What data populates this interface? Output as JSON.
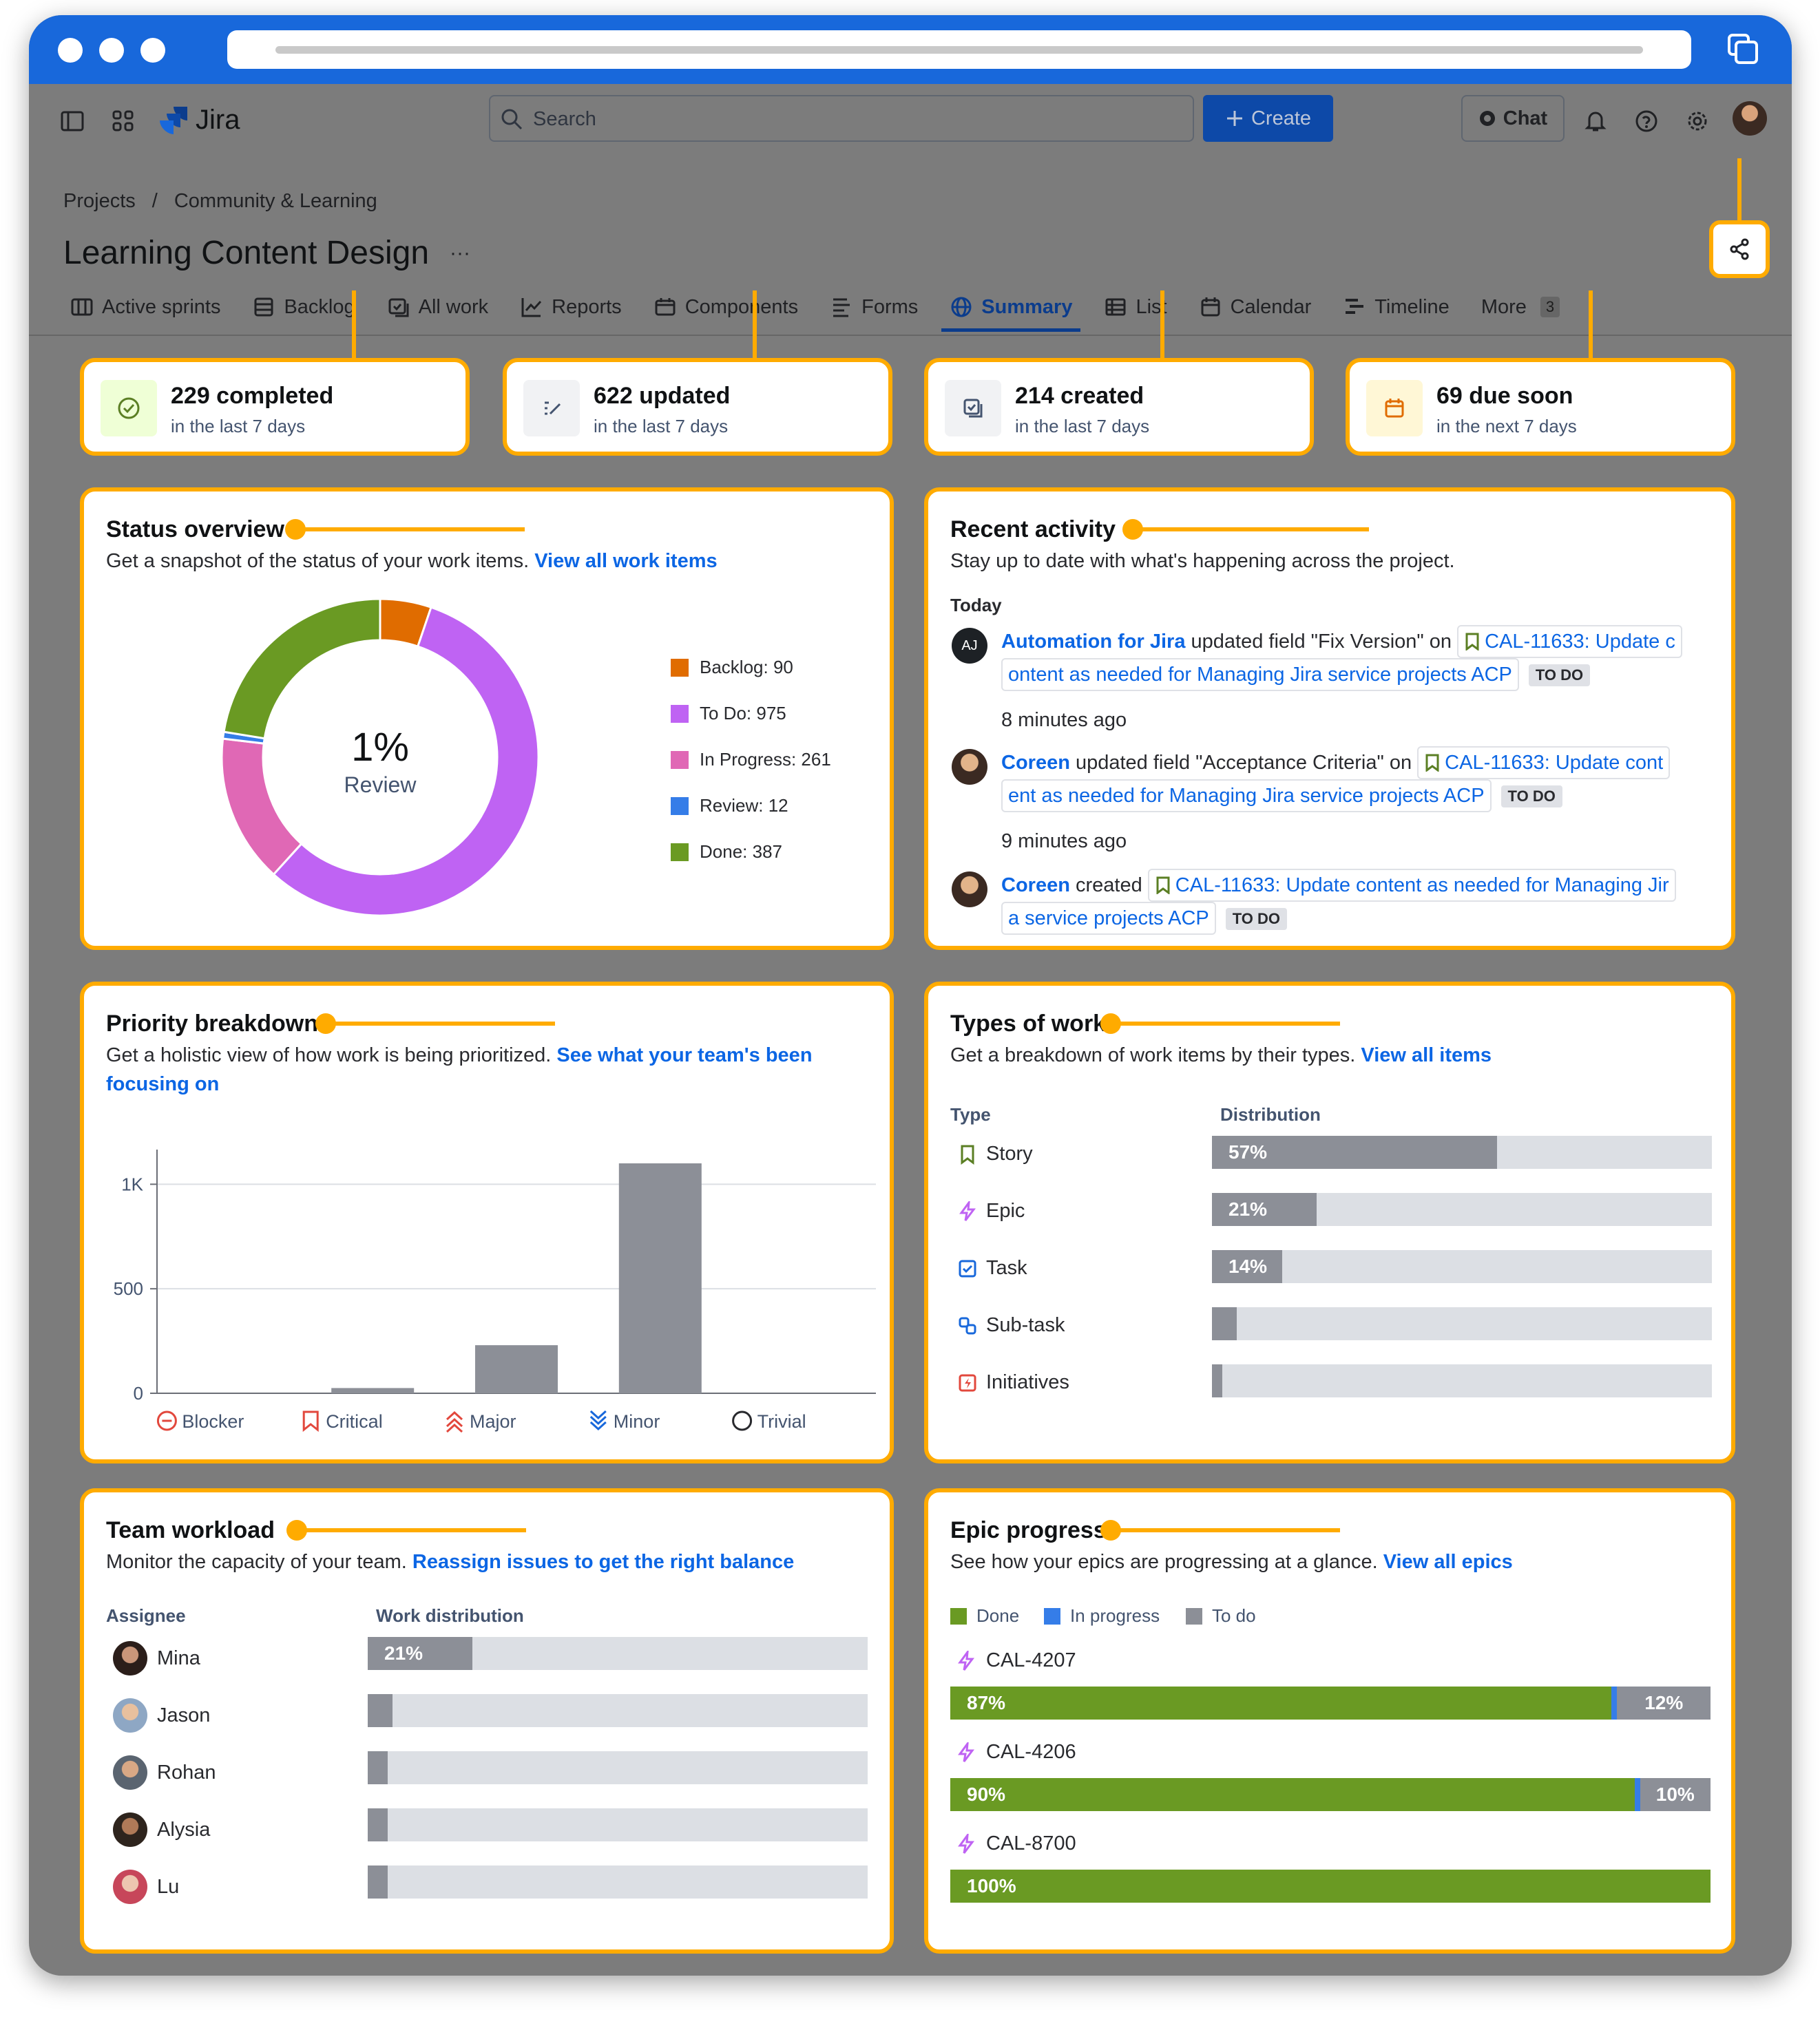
{
  "app": {
    "name": "Jira"
  },
  "topbar": {
    "search_placeholder": "Search",
    "create_label": "Create",
    "chat_label": "Chat"
  },
  "breadcrumb": {
    "root": "Projects",
    "sep": "/",
    "project": "Community & Learning"
  },
  "page": {
    "title": "Learning Content Design",
    "more": "···"
  },
  "tabs": [
    {
      "label": "Active sprints"
    },
    {
      "label": "Backlog"
    },
    {
      "label": "All work"
    },
    {
      "label": "Reports"
    },
    {
      "label": "Components"
    },
    {
      "label": "Forms"
    },
    {
      "label": "Summary"
    },
    {
      "label": "List"
    },
    {
      "label": "Calendar"
    },
    {
      "label": "Timeline"
    },
    {
      "label": "More",
      "badge": "3"
    }
  ],
  "stats": [
    {
      "big": "229 completed",
      "small": "in the last 7 days"
    },
    {
      "big": "622 updated",
      "small": "in the last 7 days"
    },
    {
      "big": "214 created",
      "small": "in the last 7 days"
    },
    {
      "big": "69 due soon",
      "small": "in the next 7 days"
    }
  ],
  "status_overview": {
    "title": "Status overview",
    "subtitle": "Get a snapshot of the status of your work items.",
    "link": "View all work items",
    "center_value": "1%",
    "center_label": "Review",
    "chart_data": {
      "type": "pie",
      "donut": true,
      "slices": [
        {
          "label": "Backlog: 90",
          "value": 90,
          "color": "#e06c00"
        },
        {
          "label": "To Do: 975",
          "value": 975,
          "color": "#bf63f3"
        },
        {
          "label": "In Progress: 261",
          "value": 261,
          "color": "#e068b5"
        },
        {
          "label": "Review: 12",
          "value": 12,
          "color": "#357de8"
        },
        {
          "label": "Done: 387",
          "value": 387,
          "color": "#6a9a23"
        }
      ]
    }
  },
  "recent_activity": {
    "title": "Recent activity",
    "subtitle": "Stay up to date with what's happening across the project.",
    "day": "Today",
    "items": [
      {
        "user": "Automation for Jira",
        "initials": "AJ",
        "action": "updated field \"Fix Version\" on",
        "item_line1": "CAL-11633: Update c",
        "item_line2": "ontent as needed for Managing Jira service projects ACP",
        "status": "TO DO",
        "time": "8 minutes ago"
      },
      {
        "user": "Coreen",
        "action": "updated field \"Acceptance Criteria\" on",
        "item_line1": "CAL-11633: Update cont",
        "item_line2": "ent as needed for Managing Jira service projects ACP",
        "status": "TO DO",
        "time": "9 minutes ago"
      },
      {
        "user": "Coreen",
        "action": "created",
        "item_line1": "CAL-11633: Update content as needed for Managing Jir",
        "item_line2": "a service projects ACP",
        "status": "TO DO"
      }
    ]
  },
  "priority_breakdown": {
    "title": "Priority breakdown",
    "subtitle": "Get a holistic view of how work is being prioritized.",
    "link_line1": "See what your team's been",
    "link_line2": "focusing on",
    "chart_data": {
      "type": "bar",
      "categories": [
        "Blocker",
        "Critical",
        "Major",
        "Minor",
        "Trivial"
      ],
      "values": [
        0,
        25,
        230,
        1100,
        0
      ],
      "ylim": [
        0,
        1100
      ],
      "yticks": [
        {
          "value": 0,
          "label": "0"
        },
        {
          "value": 500,
          "label": "500"
        },
        {
          "value": 1000,
          "label": "1K"
        }
      ],
      "bar_color": "#8c8f97",
      "grid": true
    }
  },
  "types_of_work": {
    "title": "Types of work",
    "subtitle": "Get a breakdown of work items by their types.",
    "link": "View all items",
    "col_type": "Type",
    "col_dist": "Distribution",
    "rows": [
      {
        "label": "Story",
        "percent": 57,
        "text": "57%",
        "icon": "bookmark-icon"
      },
      {
        "label": "Epic",
        "percent": 21,
        "text": "21%",
        "icon": "lightning-icon"
      },
      {
        "label": "Task",
        "percent": 14,
        "text": "14%",
        "icon": "checkbox-icon"
      },
      {
        "label": "Sub-task",
        "percent": 5,
        "text": "",
        "icon": "subtask-icon"
      },
      {
        "label": "Initiatives",
        "percent": 2,
        "text": "",
        "icon": "initiative-icon"
      }
    ]
  },
  "team_workload": {
    "title": "Team workload",
    "subtitle": "Monitor the capacity of your team.",
    "link": "Reassign issues to get the right balance",
    "col_assignee": "Assignee",
    "col_dist": "Work distribution",
    "rows": [
      {
        "name": "Mina",
        "percent": 21,
        "text": "21%"
      },
      {
        "name": "Jason",
        "percent": 5,
        "text": ""
      },
      {
        "name": "Rohan",
        "percent": 4,
        "text": ""
      },
      {
        "name": "Alysia",
        "percent": 4,
        "text": ""
      },
      {
        "name": "Lu",
        "percent": 4,
        "text": ""
      }
    ]
  },
  "epic_progress": {
    "title": "Epic progress",
    "subtitle": "See how your epics are progressing at a glance.",
    "link": "View all epics",
    "legend": {
      "done": "Done",
      "in_progress": "In progress",
      "todo": "To do"
    },
    "colors": {
      "done": "#6a9a23",
      "in_progress": "#357de8",
      "todo": "#8c8f97"
    },
    "epics": [
      {
        "key": "CAL-4207",
        "done": 87,
        "done_text": "87%",
        "todo": 12,
        "todo_text": "12%"
      },
      {
        "key": "CAL-4206",
        "done": 90,
        "done_text": "90%",
        "todo": 10,
        "todo_text": "10%"
      },
      {
        "key": "CAL-8700",
        "done": 100,
        "done_text": "100%",
        "todo": 0,
        "todo_text": ""
      }
    ]
  }
}
